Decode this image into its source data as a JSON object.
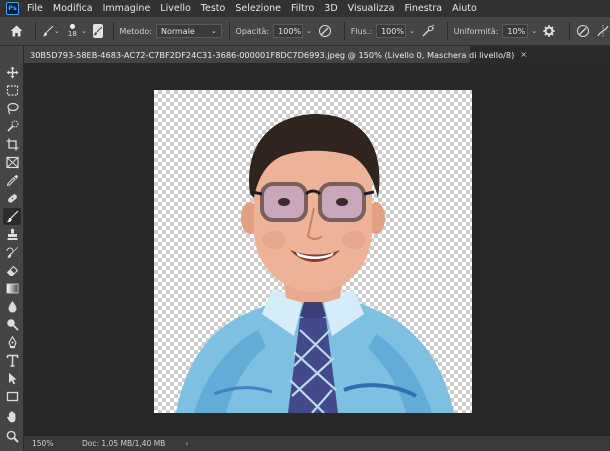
{
  "app": {
    "logo": "Ps"
  },
  "menu": [
    "File",
    "Modifica",
    "Immagine",
    "Livello",
    "Testo",
    "Selezione",
    "Filtro",
    "3D",
    "Visualizza",
    "Finestra",
    "Aiuto"
  ],
  "options": {
    "brush_size": "18",
    "method_label": "Metodo:",
    "method_value": "Normale",
    "opacity_label": "Opacità:",
    "opacity_value": "100%",
    "flow_label": "Flus.:",
    "flow_value": "100%",
    "smoothing_label": "Uniformità:",
    "smoothing_value": "10%"
  },
  "document": {
    "tab_title": "30B5D793-58EB-4683-AC72-C7BF2DF24C31-3686-000001F8DC7D6993.jpeg @ 150% (Livello 0, Maschera di livello/8)",
    "close": "×"
  },
  "status": {
    "zoom": "150%",
    "doc_size": "Doc: 1,05 MB/1,40 MB",
    "arrow": "›"
  },
  "tools": [
    "move-tool",
    "marquee-tool",
    "lasso-tool",
    "quick-selection-tool",
    "crop-tool",
    "frame-tool",
    "eyedropper-tool",
    "healing-brush-tool",
    "brush-tool",
    "clone-stamp-tool",
    "history-brush-tool",
    "eraser-tool",
    "gradient-tool",
    "blur-tool",
    "dodge-tool",
    "pen-tool",
    "type-tool",
    "path-selection-tool",
    "rectangle-tool",
    "hand-tool",
    "zoom-tool"
  ],
  "colors": {
    "accent": "#31a8ff",
    "menubar": "#323232",
    "panel": "#454545",
    "workspace": "#282828"
  }
}
